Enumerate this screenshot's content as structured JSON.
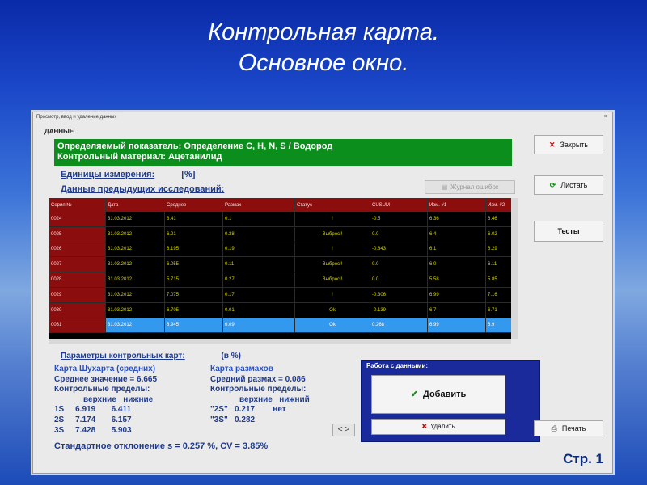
{
  "slide": {
    "title_line1": "Контрольная карта.",
    "title_line2": "Основное окно.",
    "page": "Стр. 1"
  },
  "window": {
    "caption": "Просмотр, ввод и удаление данных",
    "section": "ДАННЫЕ",
    "header_line1": "Определяемый показатель: Определение C, H, N, S / Водород",
    "header_line2": "Контрольный материал:   Ацетанилид",
    "units_label": "Единицы измерения:",
    "units_value": "[%]",
    "prev_label": "Данные предыдущих исследований:",
    "log_button": "Журнал ошибок"
  },
  "grid": {
    "columns": [
      "Серия №",
      "Дата",
      "Среднее",
      "Размах",
      "Статус",
      "CUSUM",
      "Изм. #1",
      "Изм. #2"
    ],
    "rows": [
      [
        "0024",
        "31.03.2012",
        "6.41",
        "0.1",
        "!",
        "-0.5",
        "6.36",
        "6.46"
      ],
      [
        "0025",
        "31.03.2012",
        "6.21",
        "0.38",
        "Выброс!!",
        "0.0",
        "6.4",
        "6.02"
      ],
      [
        "0026",
        "31.03.2012",
        "6.195",
        "0.19",
        "!",
        "-0.843",
        "6.1",
        "6.29"
      ],
      [
        "0027",
        "31.03.2012",
        "6.055",
        "0.11",
        "Выброс!!",
        "0.0",
        "6.0",
        "6.11"
      ],
      [
        "0028",
        "31.03.2012",
        "5.715",
        "0.27",
        "Выброс!!",
        "0.0",
        "5.58",
        "5.85"
      ],
      [
        "0029",
        "31.03.2012",
        "7.075",
        "0.17",
        "!",
        "-0.306",
        "6.99",
        "7.16"
      ],
      [
        "0030",
        "31.03.2012",
        "6.705",
        "0.01",
        "Ok",
        "-0.139",
        "6.7",
        "6.71"
      ],
      [
        "0031",
        "31.03.2012",
        "6.945",
        "0.09",
        "Ok",
        "0.268",
        "6.99",
        "6.9"
      ]
    ],
    "selected_row": 7
  },
  "params": {
    "title": "Параметры контрольных карт:",
    "unit": "(в %)",
    "shewhart": {
      "title": "Карта Шухарта (средних)",
      "mean": "Среднее значение = 6.665",
      "limits_label": "Контрольные пределы:",
      "col_headers": "верхние   нижние",
      "r1": "1S     6.919       6.411",
      "r2": "2S     7.174       6.157",
      "r3": "3S     7.428       5.903"
    },
    "range": {
      "title": "Карта размахов",
      "mean_range": "Средний размах = 0.086",
      "limits_label": "Контрольные пределы:",
      "col_headers": "верхние   нижний",
      "r1": "\"2S\"   0.217        нет",
      "r2": "\"3S\"   0.282"
    },
    "stddev": "Стандартное отклонение s = 0.257 %,  CV = 3.85%"
  },
  "data_panel": {
    "title": "Работа с данными:",
    "add": "Добавить",
    "delete": "Удалить"
  },
  "side_buttons": {
    "close": "Закрыть",
    "list": "Листать",
    "tests": "Тесты",
    "print": "Печать"
  },
  "nav": {
    "prev": "<",
    "next": ">"
  },
  "colors": {
    "accent_green": "#0b8e1b",
    "grid_header": "#8c0d0d",
    "grid_text": "#d8d800",
    "selected_row": "#3399ee",
    "panel_blue": "#1a2a9a"
  }
}
